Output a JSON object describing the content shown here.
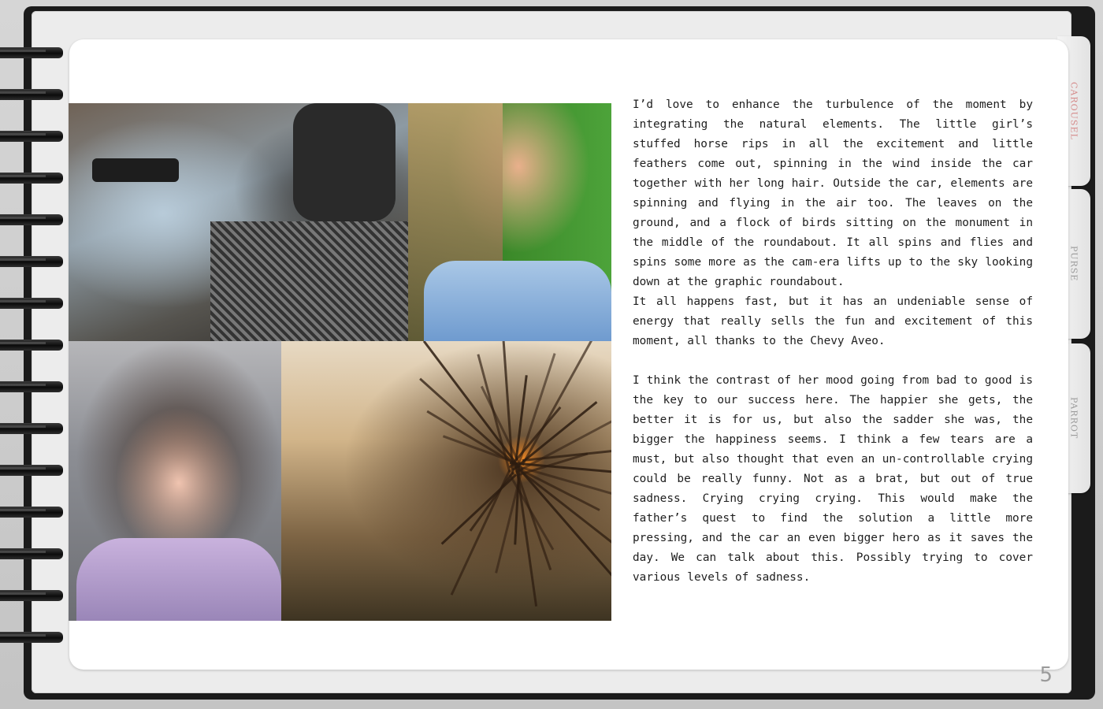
{
  "tabs": [
    {
      "label": "CAROUSEL",
      "active": true
    },
    {
      "label": "PURSE",
      "active": false
    },
    {
      "label": "PARROT",
      "active": false
    }
  ],
  "body": {
    "paragraph_1": "I’d love to enhance the turbulence of the moment by integrating the natural elements. The little girl’s stuffed horse rips in all the excitement and little feathers come out, spinning in the wind inside the car together with her long hair. Outside the car, elements are spinning and flying in the air too. The leaves on the ground, and a flock of birds sitting on the monument in the middle of the roundabout. It all spins and flies and spins some more as the cam-era lifts up to the sky looking down at the graphic roundabout.",
    "paragraph_2": "It all happens fast, but it has an undeniable sense of energy that really sells the fun and excitement of this moment, all thanks to the Chevy Aveo.",
    "paragraph_3": "I think the contrast of her mood going from bad to good is the key to our success here. The happier she gets, the better it is for us, but also the sadder she was, the bigger the happiness seems. I think a few tears are a must, but also thought that even an un-controllable crying could be really funny. Not as a brat, but out of true sadness. Crying crying crying. This would make the father’s quest to find the solution a little more pressing, and the car an even bigger hero as it saves the day. We can talk about this. Possibly trying to cover various levels of sadness."
  },
  "page_number": "5",
  "colors": {
    "active_tab": "#d58b8b",
    "inactive_tab": "#9b9b9b",
    "binder": "#1b1b1b",
    "page": "#ffffff"
  }
}
